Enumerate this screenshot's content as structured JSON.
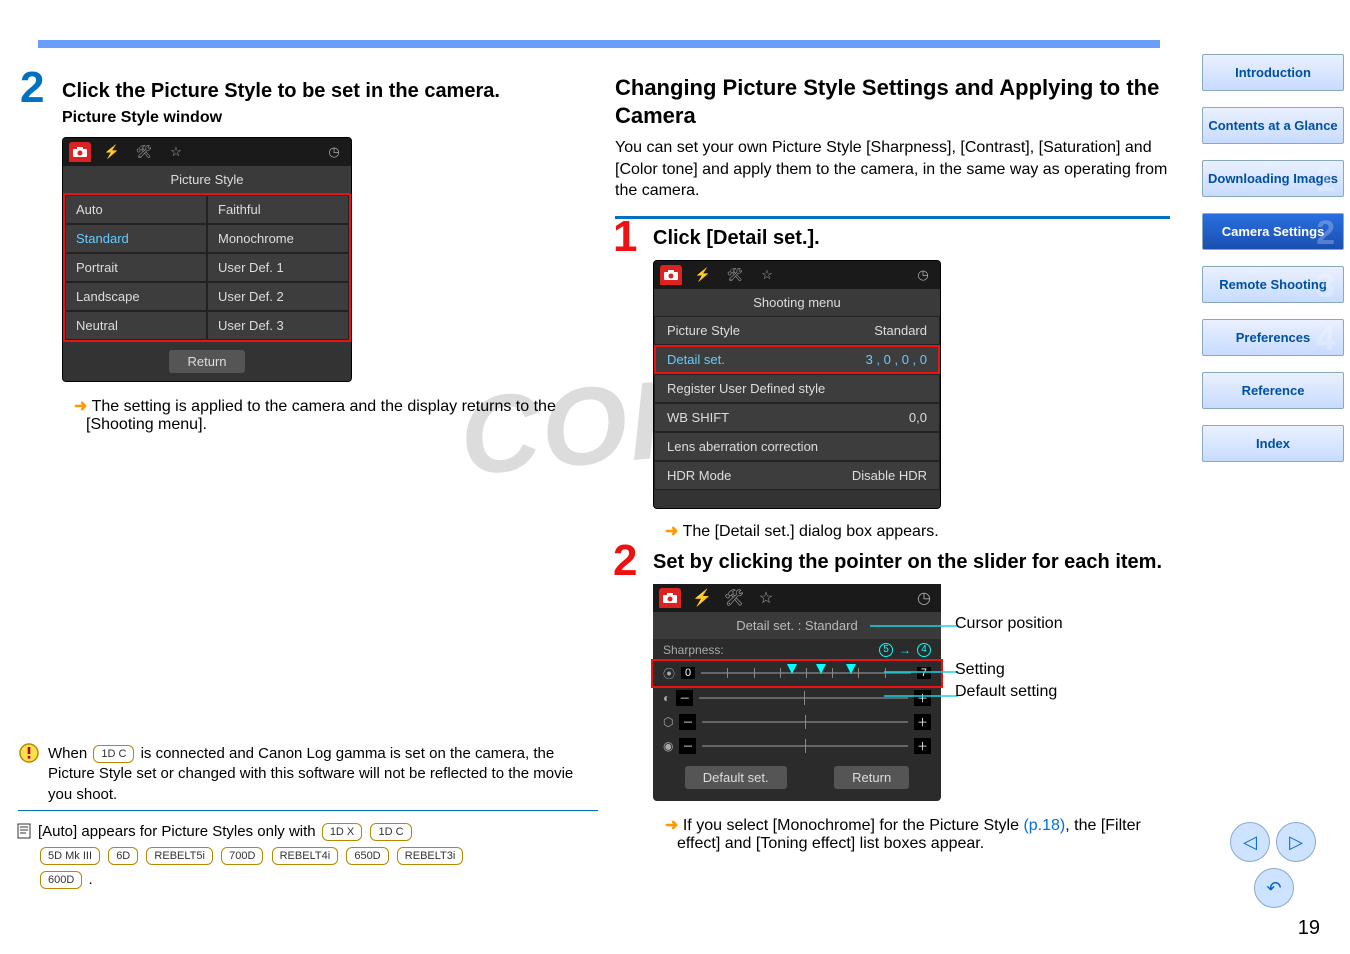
{
  "page_number": "19",
  "top_rule": true,
  "left": {
    "step2_heading": "Click the Picture Style to be set in the camera.",
    "subheading": "Picture Style window",
    "win_title": "Picture Style",
    "cells": {
      "a1": "Auto",
      "a2": "Faithful",
      "b1": "Standard",
      "b2": "Monochrome",
      "c1": "Portrait",
      "c2": "User Def. 1",
      "d1": "Landscape",
      "d2": "User Def. 2",
      "e1": "Neutral",
      "e2": "User Def. 3"
    },
    "return_btn": "Return",
    "arrow_note": "The setting is applied to the camera and the display returns to the [Shooting menu].",
    "warning_note_pre": "When ",
    "warning_chip": "1D C",
    "warning_note_post": " is connected and Canon Log gamma is set on the camera, the Picture Style set or changed with this software will not be reflected to the movie you shoot.",
    "footnote_pre": "[Auto] appears for Picture Styles only with ",
    "chips": [
      "1D X",
      "1D C",
      "5D Mk III",
      "6D",
      "REBELT5i",
      "700D",
      "REBELT4i",
      "650D",
      "REBELT3i",
      "600D"
    ],
    "footnote_post": "."
  },
  "right": {
    "h2": "Changing Picture Style Settings and Applying to the Camera",
    "intro": "You can set your own Picture Style [Sharpness], [Contrast], [Saturation] and [Color tone] and apply them to the camera, in the same way as operating from the camera.",
    "step1_heading": "Click [Detail set.].",
    "menu_title": "Shooting menu",
    "menu_rows": {
      "r1l": "Picture Style",
      "r1r": "Standard",
      "r2l": "Detail set.",
      "r2r": "3 , 0 , 0 , 0",
      "r3": "Register User Defined style",
      "r4l": "WB SHIFT",
      "r4r": "0,0",
      "r5": "Lens aberration correction",
      "r6l": "HDR Mode",
      "r6r": "Disable HDR"
    },
    "arrow_note1": "The [Detail set.] dialog box appears.",
    "step2_heading": "Set by clicking the pointer on the slider for each item.",
    "detail_title": "Detail set. : Standard",
    "sharp_label": "Sharpness:",
    "sharp_cur": "5",
    "sharp_def": "4",
    "slider_end_lo": "0",
    "slider_end_hi_sharp": "7",
    "default_set_btn": "Default set.",
    "return_btn": "Return",
    "callouts": {
      "cursor": "Cursor position",
      "setting": "Setting",
      "default": "Default setting"
    },
    "arrow_note2_pre": "If you select [Monochrome] for the Picture Style ",
    "arrow_note2_link": "(p.18)",
    "arrow_note2_post": ", the [Filter effect] and [Toning effect] list boxes appear."
  },
  "sidebar": {
    "items": [
      {
        "label": "Introduction",
        "ghost": ""
      },
      {
        "label": "Contents at a Glance",
        "ghost": ""
      },
      {
        "label": "Downloading Images",
        "ghost": "1"
      },
      {
        "label": "Camera Settings",
        "ghost": "2",
        "active": true
      },
      {
        "label": "Remote Shooting",
        "ghost": "3"
      },
      {
        "label": "Preferences",
        "ghost": "4"
      },
      {
        "label": "Reference",
        "ghost": ""
      },
      {
        "label": "Index",
        "ghost": ""
      }
    ]
  },
  "icons": {
    "camera": "📷",
    "flash": "⚡",
    "tools": "🔧",
    "star": "⭐",
    "clock": "◷",
    "contrast": "◐",
    "saturation": "◉",
    "colortone": "◍",
    "plus": "＋",
    "minus": "－"
  }
}
